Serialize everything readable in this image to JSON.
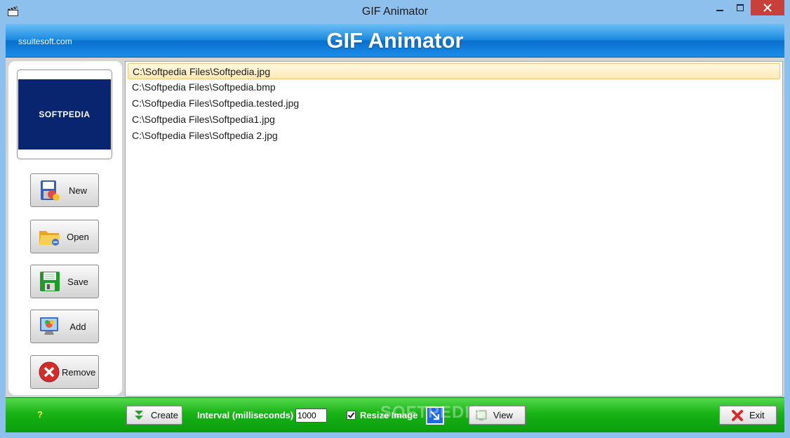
{
  "window": {
    "title": "GIF Animator"
  },
  "banner": {
    "site": "ssuitesoft.com",
    "heading": "GIF Animator"
  },
  "preview": {
    "logo_text": "SOFTPEDIA"
  },
  "sidebar": {
    "buttons": [
      {
        "label": "New",
        "icon": "new-file-icon"
      },
      {
        "label": "Open",
        "icon": "folder-open-icon"
      },
      {
        "label": "Save",
        "icon": "floppy-disk-icon"
      },
      {
        "label": "Add",
        "icon": "add-image-icon"
      },
      {
        "label": "Remove",
        "icon": "remove-icon"
      }
    ]
  },
  "files": [
    "C:\\Softpedia Files\\Softpedia.jpg",
    "C:\\Softpedia Files\\Softpedia.bmp",
    "C:\\Softpedia Files\\Softpedia.tested.jpg",
    "C:\\Softpedia Files\\Softpedia1.jpg",
    "C:\\Softpedia Files\\Softpedia 2.jpg"
  ],
  "selected_index": 0,
  "bottom": {
    "help": "?",
    "create_label": "Create",
    "interval_label": "Interval (milliseconds)",
    "interval_value": "1000",
    "resize_label": "Resize Image",
    "resize_checked": true,
    "view_label": "View",
    "exit_label": "Exit"
  },
  "watermark": "SOFTPEDIA",
  "colors": {
    "titlebar": "#8ec0ee",
    "banner_blue": "#0a6fcc",
    "bar_green": "#18b316",
    "close_red": "#c7403a",
    "help_yellow": "#f3ee4a"
  }
}
